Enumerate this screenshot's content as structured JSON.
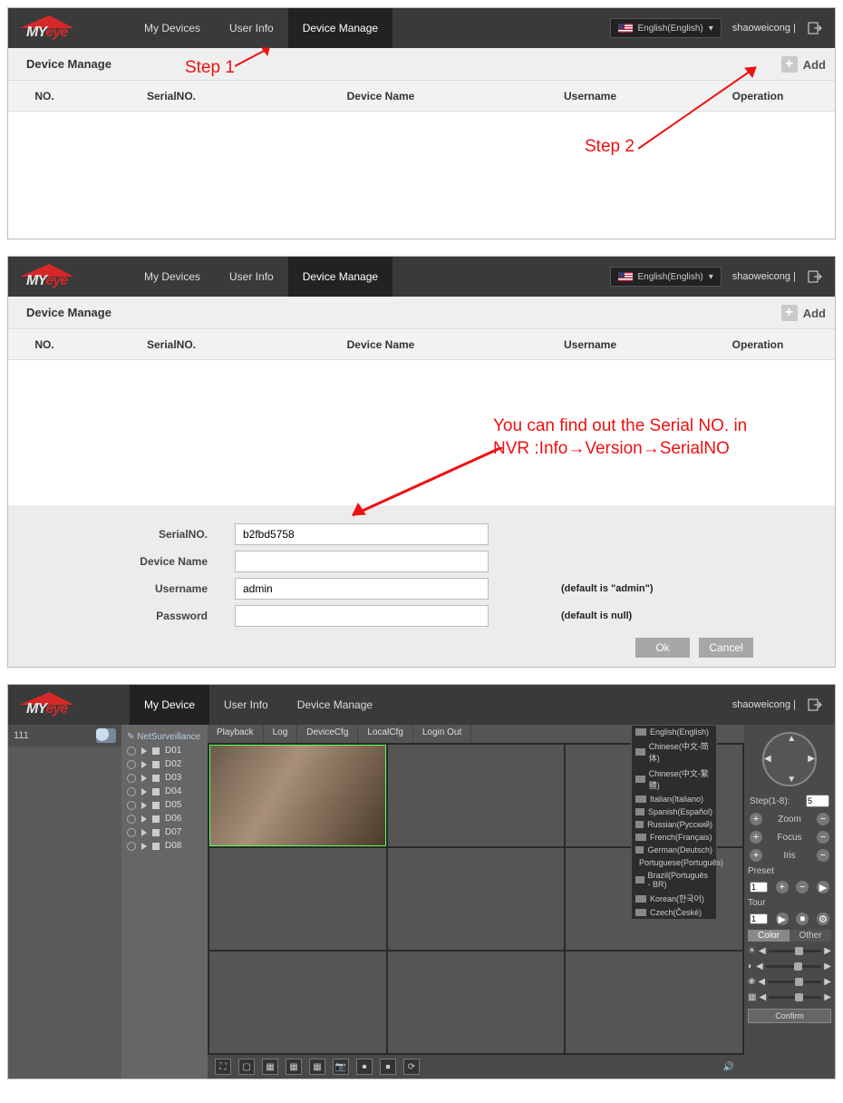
{
  "brand": {
    "name": "MYeye"
  },
  "nav": {
    "my_devices": "My Devices",
    "my_device": "My Device",
    "user_info": "User Info",
    "device_manage": "Device Manage"
  },
  "lang_selected": "English(English)",
  "languages": [
    "English(English)",
    "Chinese(中文-简体)",
    "Chinese(中文-繁體)",
    "Italian(Italiano)",
    "Spanish(Español)",
    "Russian(Русский)",
    "French(Français)",
    "German(Deutsch)",
    "Portuguese(Português)",
    "Brazil(Português - BR)",
    "Korean(한국어)",
    "Czech(České)"
  ],
  "username_top": "shaoweicong",
  "page_title": "Device Manage",
  "add_label": "Add",
  "columns": {
    "no": "NO.",
    "serial": "SerialNO.",
    "device_name": "Device Name",
    "username": "Username",
    "operation": "Operation"
  },
  "annotations": {
    "step1": "Step 1",
    "step2": "Step 2",
    "serial_hint": "You can find out the Serial NO. in NVR :Info→Version→SerialNO"
  },
  "form": {
    "serial_label": "SerialNO.",
    "serial_value": "b2fbd5758",
    "devicename_label": "Device Name",
    "devicename_value": "",
    "username_label": "Username",
    "username_value": "admin",
    "username_hint": "(default is \"admin\")",
    "password_label": "Password",
    "password_value": "",
    "password_hint": "(default is null)",
    "ok": "Ok",
    "cancel": "Cancel"
  },
  "live": {
    "device": "111",
    "netsurveillance": "NetSurveillance",
    "channels": [
      "D01",
      "D02",
      "D03",
      "D04",
      "D05",
      "D06",
      "D07",
      "D08"
    ],
    "tabs": [
      "Playback",
      "Log",
      "DeviceCfg",
      "LocalCfg",
      "Login Out"
    ],
    "ptz": {
      "step_label": "Step(1-8):",
      "step_value": "5",
      "zoom": "Zoom",
      "focus": "Focus",
      "iris": "Iris",
      "preset": "Preset",
      "tour": "Tour",
      "tab_color": "Color",
      "tab_other": "Other",
      "confirm": "Confirm"
    }
  }
}
